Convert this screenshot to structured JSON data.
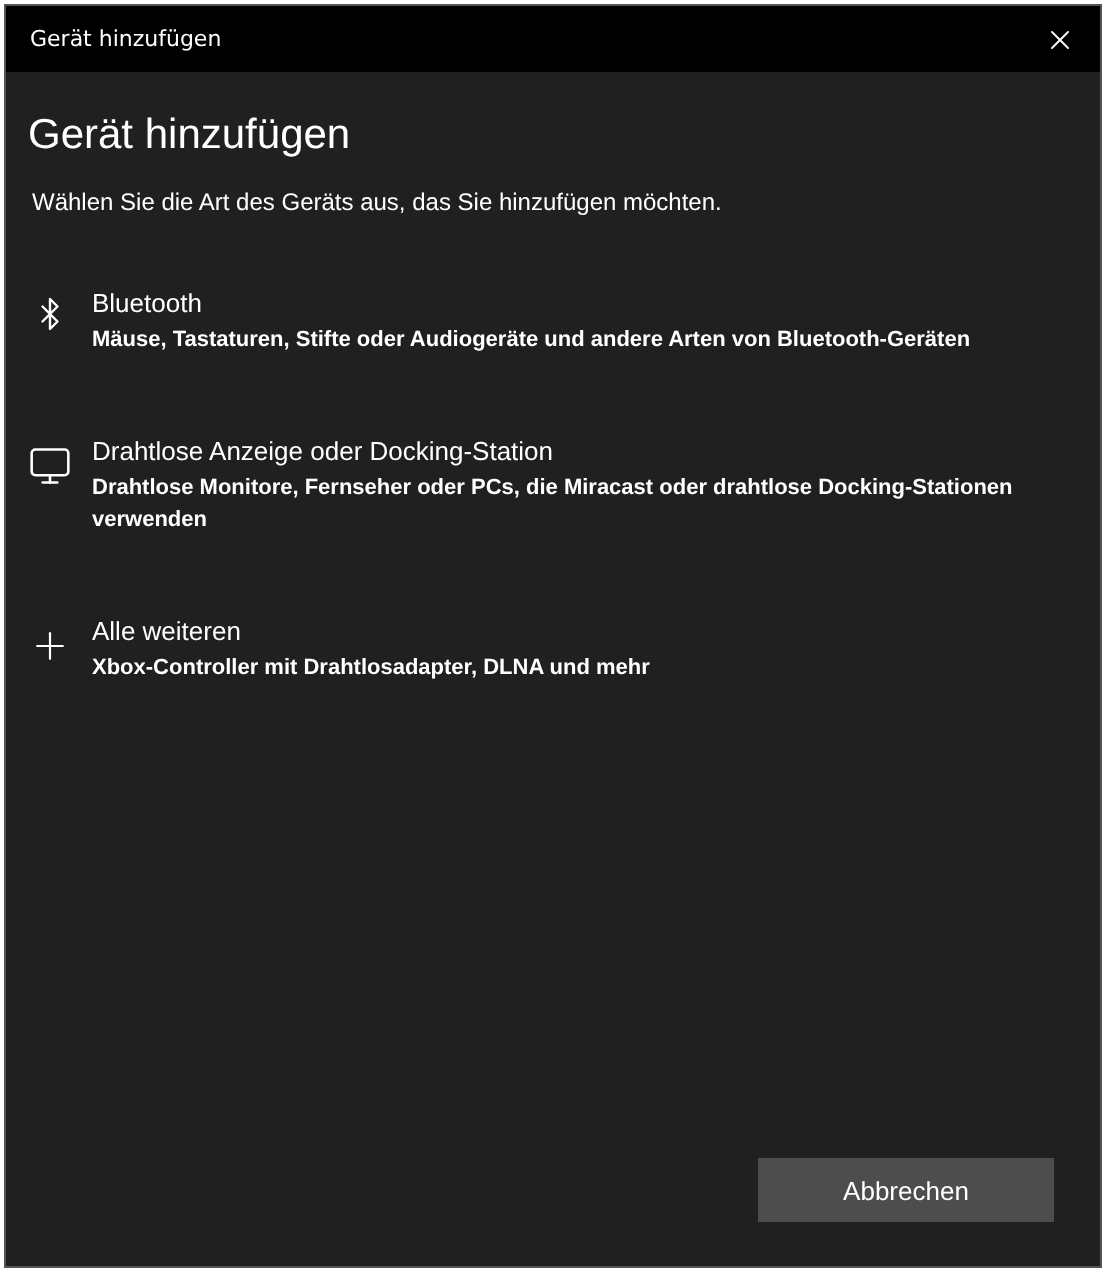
{
  "window": {
    "title": "Gerät hinzufügen"
  },
  "heading": "Gerät hinzufügen",
  "instruction": "Wählen Sie die Art des Geräts aus, das Sie hinzufügen möchten.",
  "options": [
    {
      "kind": "bluetooth",
      "title": "Bluetooth",
      "description": "Mäuse, Tastaturen, Stifte oder Audiogeräte und andere Arten von Bluetooth-Geräten"
    },
    {
      "kind": "display",
      "title": "Drahtlose Anzeige oder Docking-Station",
      "description": "Drahtlose Monitore, Fernseher oder PCs, die Miracast oder drahtlose Docking-Stationen verwenden"
    },
    {
      "kind": "other",
      "title": "Alle weiteren",
      "description": "Xbox-Controller mit Drahtlosadapter, DLNA und mehr"
    }
  ],
  "buttons": [
    "Abbrechen"
  ]
}
